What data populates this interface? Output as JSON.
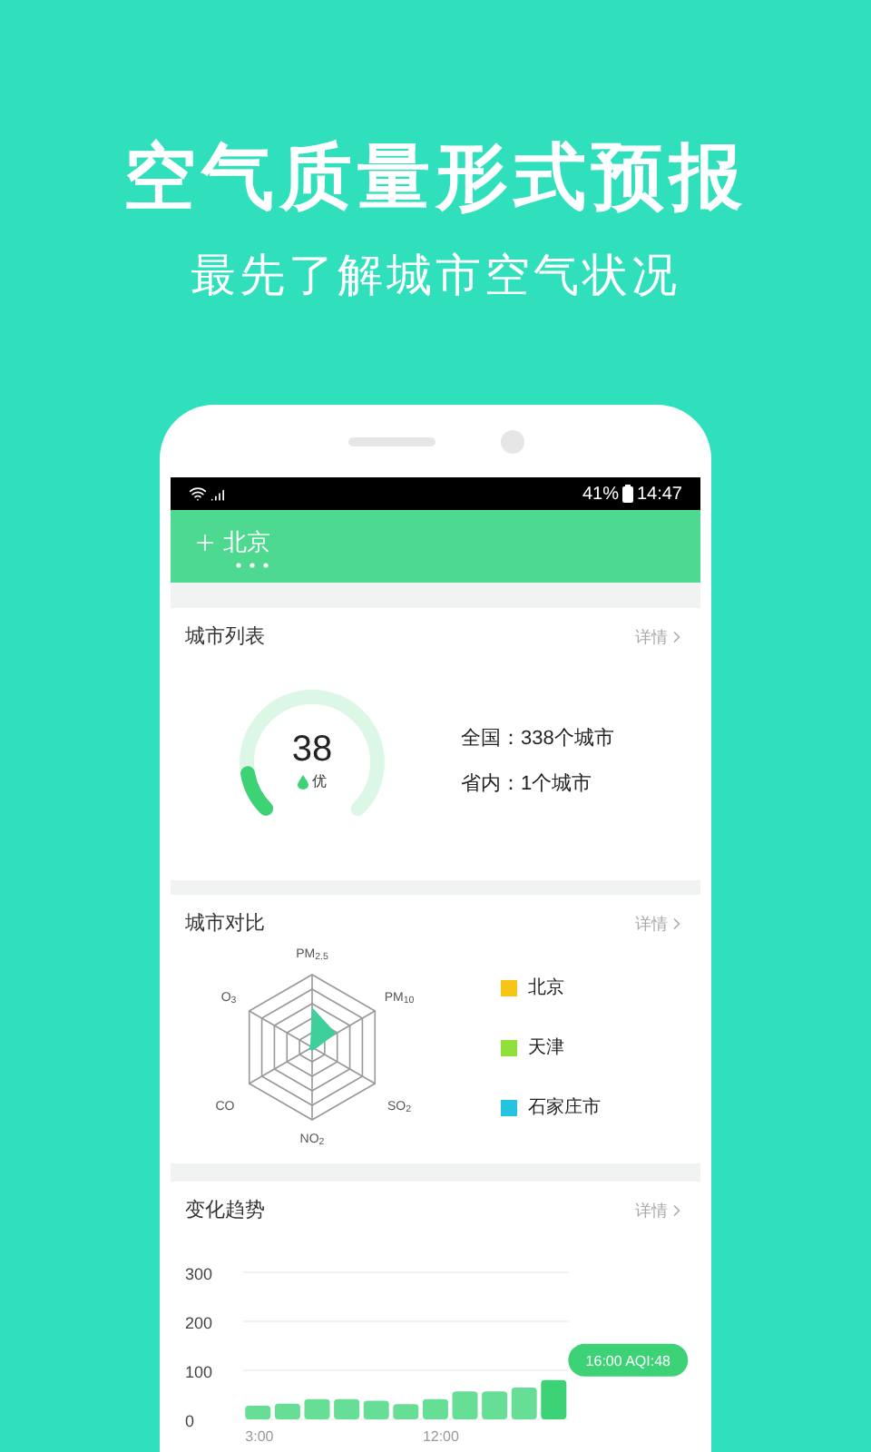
{
  "promo": {
    "title": "空气质量形式预报",
    "subtitle": "最先了解城市空气状况"
  },
  "status_bar": {
    "battery": "41%",
    "time": "14:47"
  },
  "header": {
    "city": "北京"
  },
  "city_list": {
    "title": "城市列表",
    "more": "详情",
    "aqi": "38",
    "grade": "优",
    "level": 0.13,
    "stats": [
      "全国：338个城市",
      "省内：1个城市"
    ]
  },
  "city_compare": {
    "title": "城市对比",
    "more": "详情",
    "axes": [
      "PM$_{2.5}$",
      "PM$_{10}$",
      "SO$_{2}$",
      "NO$_{2}$",
      "CO",
      "O$_{3}$"
    ],
    "legend": [
      {
        "name": "北京",
        "color": "#f5c518"
      },
      {
        "name": "天津",
        "color": "#8fe03a"
      },
      {
        "name": "石家庄市",
        "color": "#22c4e0"
      }
    ]
  },
  "trend": {
    "title": "变化趋势",
    "more": "详情",
    "chart_data": {
      "type": "bar",
      "values": [
        28,
        32,
        41,
        41,
        38,
        31,
        41,
        57,
        57,
        65,
        80
      ],
      "ylim": [
        0,
        300
      ],
      "yticks": [
        0,
        100,
        200,
        300
      ],
      "annotations": [
        "16:00 AQI:48"
      ]
    },
    "x_labels": [
      "3:00",
      "12:00"
    ]
  }
}
